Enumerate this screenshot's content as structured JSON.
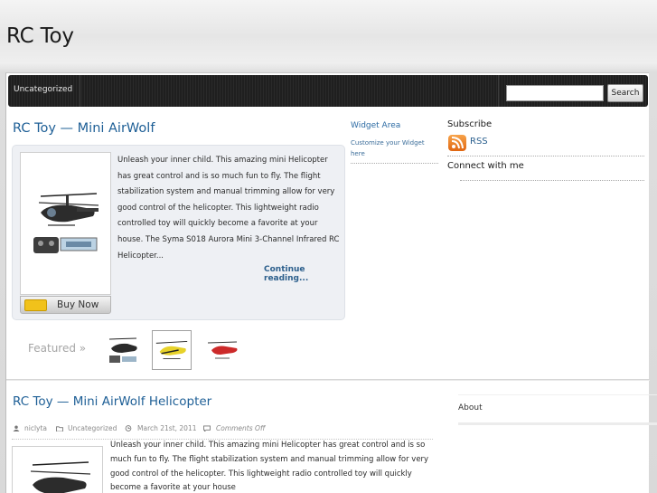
{
  "site": {
    "title": "RC Toy"
  },
  "nav": {
    "items": [
      {
        "label": "Uncategorized"
      }
    ]
  },
  "search": {
    "button_label": "Search",
    "value": ""
  },
  "post1": {
    "title": "RC Toy — Mini AirWolf",
    "excerpt": "Unleash your inner child. This amazing mini Helicopter has great control and is so much fun to fly. The flight stabilization system and manual trimming allow for very good control of the helicopter. This lightweight radio controlled toy will quickly become a favorite at your house. The Syma S018 Aurora Mini 3-Channel Infrared RC Helicopter...",
    "continue_label": "Continue reading...",
    "buy_label": "Buy Now"
  },
  "featured": {
    "label": "Featured »",
    "thumbs": [
      "helicopter-black",
      "helicopter-yellow",
      "helicopter-red"
    ]
  },
  "widget_area": {
    "title": "Widget Area",
    "text": "Customize your Widget here"
  },
  "subscribe": {
    "title": "Subscribe",
    "rss_label": "RSS"
  },
  "connect": {
    "title": "Connect with me"
  },
  "post2": {
    "title": "RC Toy — Mini AirWolf Helicopter",
    "author": "niclyta",
    "category": "Uncategorized",
    "date": "March 21st, 2011",
    "comments": "Comments Off",
    "excerpt": "Unleash your inner child. This amazing mini Helicopter has great control and is so much fun to fly. The flight stabilization system and manual trimming allow for very good control of the helicopter. This lightweight radio controlled toy will quickly become a favorite at your house"
  },
  "about": {
    "title": "About"
  },
  "colors": {
    "link": "#1e5f96",
    "nav_bg": "#1f1f1f",
    "rss": "#e06611"
  }
}
